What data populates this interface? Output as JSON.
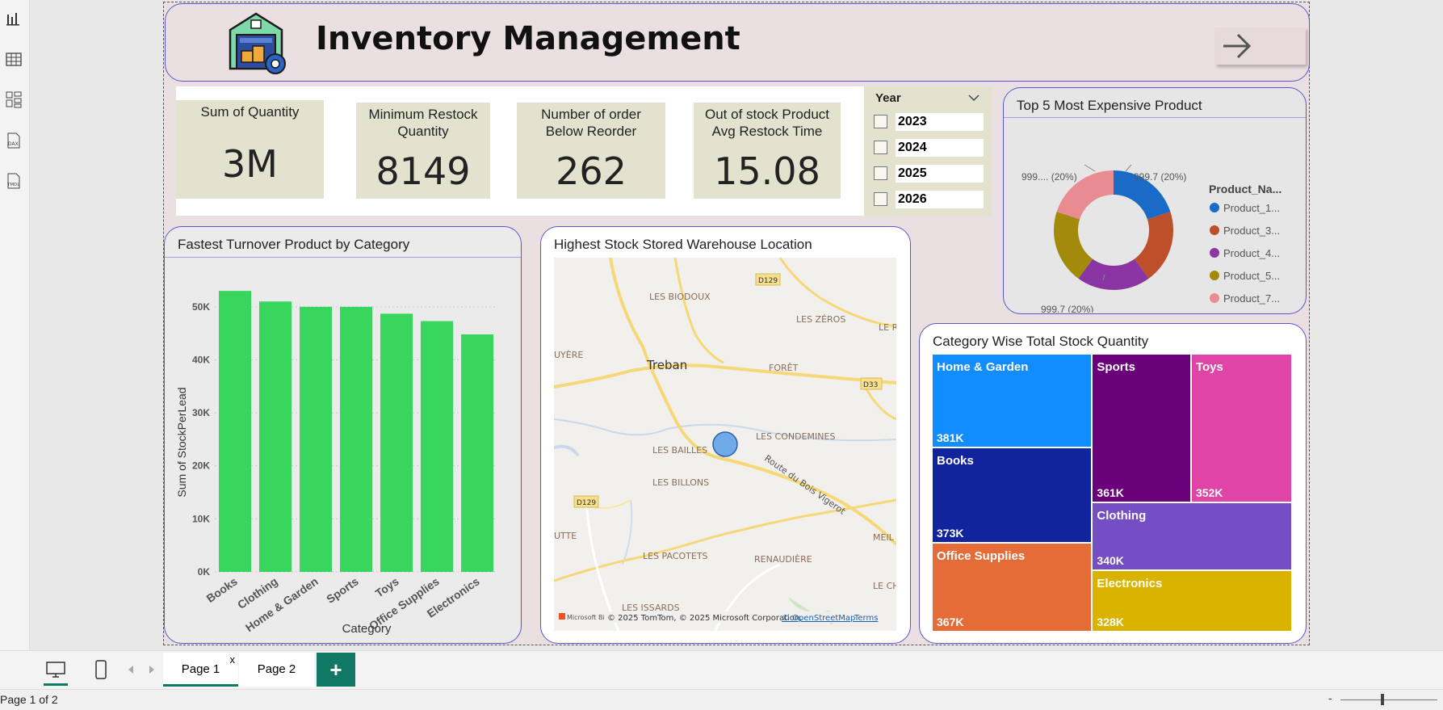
{
  "header": {
    "title": "Inventory Management"
  },
  "kpis": [
    {
      "label": "Sum of Quantity",
      "value": "3M"
    },
    {
      "label": "Minimum Restock Quantity",
      "value": "8149"
    },
    {
      "label": "Number of order Below Reorder",
      "value": "262"
    },
    {
      "label": "Out of stock Product Avg Restock Time",
      "value": "15.08"
    }
  ],
  "year_slicer": {
    "title": "Year",
    "options": [
      "2023",
      "2024",
      "2025",
      "2026"
    ]
  },
  "bar_chart": {
    "title": "Fastest Turnover Product by Category"
  },
  "map": {
    "title": "Highest Stock Stored Warehouse Location",
    "labels": [
      "LES BIODOUX",
      "LES ZÉROS",
      "Treban",
      "FORÊT",
      "UYÈRE",
      "LES CONDEMINES",
      "LES BAILLES",
      "LES BILLONS",
      "Route du Bois Vigerot",
      "UTTE",
      "LES PACOTETS",
      "RENAUDIÈRE",
      "LES ISSARDS",
      "D129",
      "D33",
      "LE R",
      "MEIL",
      "LE CH"
    ],
    "attribution": "© 2025 TomTom, © 2025 Microsoft Corporation,",
    "osm_link": "© OpenStreetMap",
    "terms_link": "Terms",
    "ms_logo": "Microsoft Bi"
  },
  "pie_chart": {
    "title": "Top 5 Most Expensive Product",
    "legend_title": "Product_Na...",
    "slices": [
      {
        "name": "Product_1...",
        "value": 999.7,
        "color": "#1a6bc8"
      },
      {
        "name": "Product_3...",
        "value": 999.7,
        "color": "#bd4f2a"
      },
      {
        "name": "Product_4...",
        "value": 999.7,
        "color": "#8a35a3"
      },
      {
        "name": "Product_5...",
        "value": 999.7,
        "color": "#a28a0a"
      },
      {
        "name": "Product_7...",
        "value": 999.7,
        "color": "#e98c92"
      }
    ],
    "data_labels": [
      "999.7 (20%)",
      "999.7 (20%)",
      "999.... (20%)"
    ]
  },
  "treemap": {
    "title": "Category Wise Total Stock Quantity",
    "cells": [
      {
        "name": "Home & Garden",
        "value": "381K",
        "color": "#118dff"
      },
      {
        "name": "Books",
        "value": "373K",
        "color": "#12239e"
      },
      {
        "name": "Office Supplies",
        "value": "367K",
        "color": "#e66c37"
      },
      {
        "name": "Sports",
        "value": "361K",
        "color": "#6b007b"
      },
      {
        "name": "Toys",
        "value": "352K",
        "color": "#e044a7"
      },
      {
        "name": "Clothing",
        "value": "340K",
        "color": "#744ec2"
      },
      {
        "name": "Electronics",
        "value": "328K",
        "color": "#d9b300"
      }
    ]
  },
  "chart_data": {
    "type": "bar",
    "title": "Fastest Turnover Product by Category",
    "categories": [
      "Books",
      "Clothing",
      "Home & Garden",
      "Sports",
      "Toys",
      "Office Supplies",
      "Electronics"
    ],
    "values": [
      53000,
      51000,
      50000,
      50000,
      48700,
      47300,
      44800
    ],
    "xlabel": "Category",
    "ylabel": "Sum of StockPerLead",
    "yticks": [
      "0K",
      "10K",
      "20K",
      "30K",
      "40K",
      "50K"
    ],
    "ylim": [
      0,
      55000
    ],
    "color": "#39d65e",
    "grid": true
  },
  "pages": {
    "tabs": [
      "Page 1",
      "Page 2"
    ],
    "close": "x",
    "add": "+"
  },
  "status": {
    "text": "Page 1 of 2",
    "zoom_minus": "-"
  }
}
